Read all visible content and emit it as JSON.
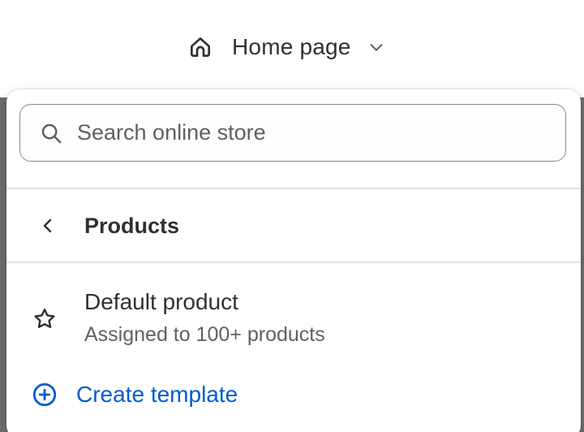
{
  "header": {
    "page_title": "Home page"
  },
  "dropdown": {
    "search": {
      "placeholder": "Search online store",
      "value": ""
    },
    "back": {
      "label": "Products"
    },
    "templates": [
      {
        "name": "Default product",
        "subtitle": "Assigned to 100+ products",
        "icon": "star-icon"
      }
    ],
    "create": {
      "label": "Create template",
      "icon": "plus-circle-icon"
    }
  },
  "colors": {
    "accent": "#005bd3",
    "text": "#303030",
    "subdued": "#616161",
    "divider": "#e3e3e3"
  }
}
